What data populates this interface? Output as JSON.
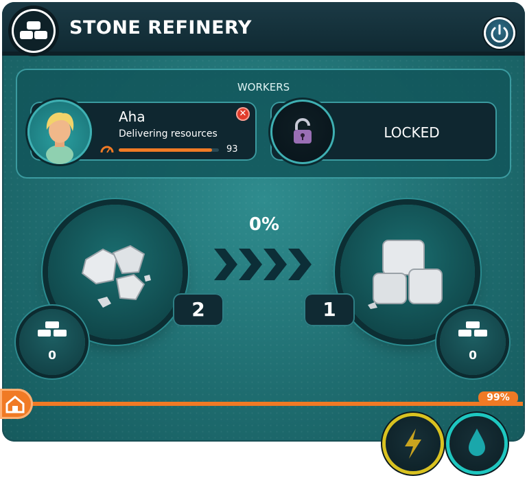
{
  "header": {
    "title": "STONE REFINERY",
    "icon": "stone-blocks-icon",
    "power_icon": "power-icon"
  },
  "workers": {
    "label": "WORKERS",
    "slots": [
      {
        "name": "Aha",
        "status": "Delivering resources",
        "energy": "93",
        "progress": 0.93,
        "close_icon": "close-icon"
      },
      {
        "status": "LOCKED",
        "icon": "padlock-icon"
      }
    ]
  },
  "process": {
    "percent": "0%",
    "input": {
      "icon": "rocks-icon",
      "count": "2"
    },
    "output": {
      "icon": "stone-block-pile-icon",
      "count": "1"
    },
    "input_storage": {
      "icon": "stone-blocks-icon",
      "count": "0"
    },
    "output_storage": {
      "icon": "stone-blocks-icon",
      "count": "0"
    }
  },
  "bottom": {
    "percent": "99%",
    "progress": 0.99,
    "home_icon": "home-icon",
    "energy_icon": "lightning-icon",
    "water_icon": "water-drop-icon"
  },
  "colors": {
    "accent": "#f07a25",
    "teal": "#1f6d70",
    "energy_ring": "#d9c220",
    "water_ring": "#1ec7c0"
  }
}
